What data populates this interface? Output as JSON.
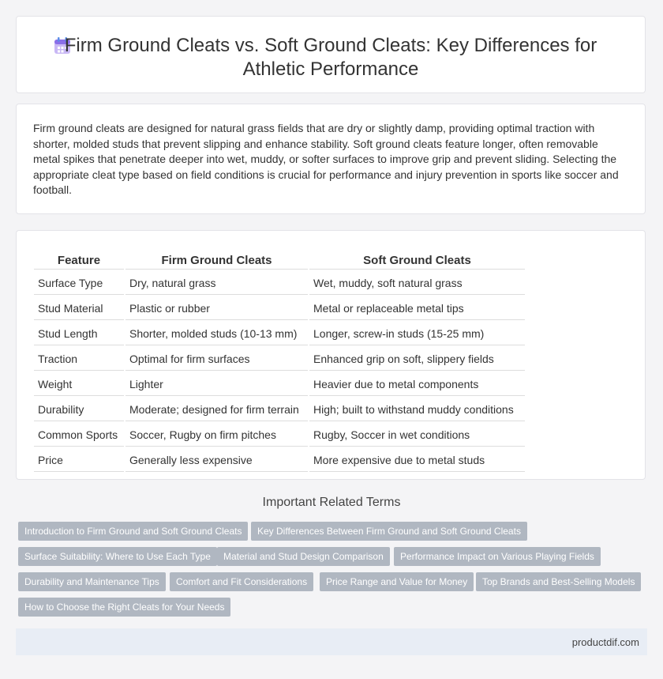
{
  "header": {
    "title_line1": "Firm Ground Cleats vs. Soft Ground Cleats: Key Differences for",
    "title_line2": "Athletic Performance",
    "icon": "calendar-icon"
  },
  "intro": {
    "text": "Firm ground cleats are designed for natural grass fields that are dry or slightly damp, providing optimal traction with shorter, molded studs that prevent slipping and enhance stability. Soft ground cleats feature longer, often removable metal spikes that penetrate deeper into wet, muddy, or softer surfaces to improve grip and prevent sliding. Selecting the appropriate cleat type based on field conditions is crucial for performance and injury prevention in sports like soccer and football."
  },
  "table": {
    "headers": [
      "Feature",
      "Firm Ground Cleats",
      "Soft Ground Cleats"
    ],
    "rows": [
      [
        "Surface Type",
        "Dry, natural grass",
        "Wet, muddy, soft natural grass"
      ],
      [
        "Stud Material",
        "Plastic or rubber",
        "Metal or replaceable metal tips"
      ],
      [
        "Stud Length",
        "Shorter, molded studs (10-13 mm)",
        "Longer, screw-in studs (15-25 mm)"
      ],
      [
        "Traction",
        "Optimal for firm surfaces",
        "Enhanced grip on soft, slippery fields"
      ],
      [
        "Weight",
        "Lighter",
        "Heavier due to metal components"
      ],
      [
        "Durability",
        "Moderate; designed for firm terrain",
        "High; built to withstand muddy conditions"
      ],
      [
        "Common Sports",
        "Soccer, Rugby on firm pitches",
        "Rugby, Soccer in wet conditions"
      ],
      [
        "Price",
        "Generally less expensive",
        "More expensive due to metal studs"
      ]
    ]
  },
  "terms": {
    "heading": "Important Related Terms",
    "tags": [
      "Introduction to Firm Ground and Soft Ground Cleats",
      "Key Differences Between Firm Ground and Soft Ground Cleats",
      "Surface Suitability: Where to Use Each Type",
      "Material and Stud Design Comparison",
      "Performance Impact on Various Playing Fields",
      "Durability and Maintenance Tips",
      "Comfort and Fit Considerations",
      "Price Range and Value for Money",
      "Top Brands and Best-Selling Models",
      "How to Choose the Right Cleats for Your Needs"
    ]
  },
  "footer": {
    "site": "productdif.com"
  }
}
